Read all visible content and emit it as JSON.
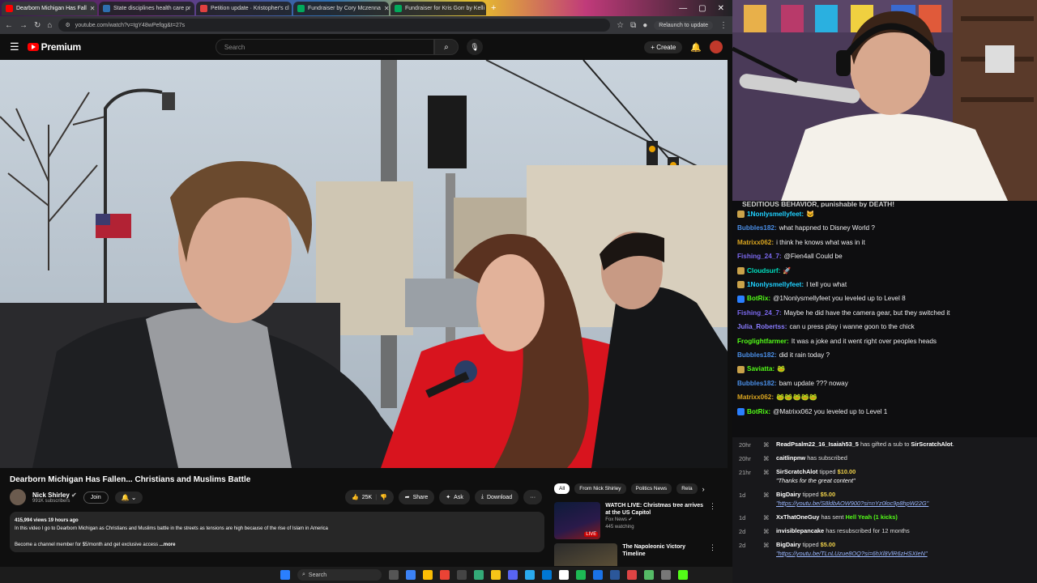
{
  "browser": {
    "tabs": [
      {
        "label": "Dearborn Michigan Has Fall",
        "color": "#ff0000",
        "active": true
      },
      {
        "label": "State disciplines health care pr",
        "color": "#2e6fb0",
        "active": false
      },
      {
        "label": "Petition update · Kristopher's cl",
        "color": "#e04040",
        "active": false
      },
      {
        "label": "Fundraiser by Cory Mczenna",
        "color": "#02a95c",
        "active": false
      },
      {
        "label": "Fundraiser for Kris Gorr by Kelli",
        "color": "#02a95c",
        "active": false
      }
    ],
    "new_tab": "+",
    "url": "youtube.com/watch?v=tgY48wPefqg&t=27s",
    "relaunch": "Relaunch to update"
  },
  "youtube": {
    "logo": "Premium",
    "search_placeholder": "Search",
    "create": "+ Create",
    "video_title": "Dearborn Michigan Has Fallen... Christians and Muslims Battle",
    "channel": {
      "name": "Nick Shirley",
      "subs": "991K subscribers",
      "join": "Join",
      "bell": "🔔 ⌄"
    },
    "actions": {
      "likes": "25K",
      "share": "Share",
      "ask": "Ask",
      "download": "Download",
      "more": "···"
    },
    "description": {
      "meta": "415,994 views  19 hours ago",
      "line1": "In this video I go to Dearborn Michigan as Christians and Muslims battle in the streets as tensions are high because of the rise of Islam in America",
      "line2": "Become a channel member for $5/month and get exclusive access",
      "more": "...more"
    },
    "chips": [
      "All",
      "From Nick Shirley",
      "Politics News",
      "Rela"
    ],
    "recommendations": [
      {
        "title": "WATCH LIVE: Christmas tree arrives at the US Capitol",
        "channel": "Fox News ✔",
        "meta": "445 watching",
        "live": "LIVE"
      },
      {
        "title": "The Napoleonic Victory Timeline",
        "channel": "",
        "meta": "",
        "live": ""
      }
    ]
  },
  "taskbar": {
    "search": "Search"
  },
  "chat": {
    "header": "SEDITIOUS BEHAVIOR, punishable by DEATH!",
    "messages": [
      {
        "user": "1Nonlysmellyfeet:",
        "color": "#1fd1ff",
        "msg": "🐱",
        "badge": "#caa24a"
      },
      {
        "user": "Bubbles182:",
        "color": "#4a8ee6",
        "msg": "what happned to Disney World ?",
        "badge": ""
      },
      {
        "user": "Matrixx062:",
        "color": "#daa520",
        "msg": "i think he knows what was in it",
        "badge": ""
      },
      {
        "user": "Fishing_24_7:",
        "color": "#7b68ee",
        "msg": "@Fien4all Could be",
        "badge": ""
      },
      {
        "user": "Cloudsurf:",
        "color": "#00e0c0",
        "msg": "🚀",
        "badge": "#caa24a"
      },
      {
        "user": "1Nonlysmellyfeet:",
        "color": "#1fd1ff",
        "msg": "I tell you what",
        "badge": "#caa24a"
      },
      {
        "user": "BotRix:",
        "color": "#53fc18",
        "msg": "@1Nonlysmellyfeet you leveled up to Level 8",
        "badge": "#2a7fff"
      },
      {
        "user": "Fishing_24_7:",
        "color": "#7b68ee",
        "msg": "Maybe he did have the camera gear, but they switched it",
        "badge": ""
      },
      {
        "user": "Julia_Robertss:",
        "color": "#8a7cff",
        "msg": "can u press play i wanne goon to the chick",
        "badge": ""
      },
      {
        "user": "Froglightfarmer:",
        "color": "#53fc18",
        "msg": "It was a joke and it went right over peoples heads",
        "badge": ""
      },
      {
        "user": "Bubbles182:",
        "color": "#4a8ee6",
        "msg": "did it rain today ?",
        "badge": ""
      },
      {
        "user": "Saviatta:",
        "color": "#53fc18",
        "msg": "🐸",
        "badge": "#caa24a"
      },
      {
        "user": "Bubbles182:",
        "color": "#4a8ee6",
        "msg": "bam update ??? noway",
        "badge": ""
      },
      {
        "user": "Matrixx062:",
        "color": "#daa520",
        "msg": "🐸🐸🐸🐸🐸",
        "badge": ""
      },
      {
        "user": "BotRix:",
        "color": "#53fc18",
        "msg": "@Matrixx062 you leveled up to Level 1",
        "badge": "#2a7fff"
      }
    ]
  },
  "events": [
    {
      "age": "20hr",
      "name": "ReadPsalm22_16_Isaiah53_5",
      "text": " has gifted a sub to ",
      "target": "SirScratchAlot",
      "end": "."
    },
    {
      "age": "20hr",
      "name": "caitlinpnw",
      "text": " has subscribed",
      "target": "",
      "end": ""
    },
    {
      "age": "21hr",
      "name": "SirScratchAlot",
      "text": " tipped ",
      "amount": "$10.00",
      "quote": "\"Thanks for the great content\""
    },
    {
      "age": "1d",
      "name": "BigDairy",
      "text": " tipped ",
      "amount": "$5.00",
      "link": "\"https://youtu.be/S8ldbAOW900?si=nYz0loc9p8hpW22G\""
    },
    {
      "age": "1d",
      "name": "XxThatOneGuy",
      "text": " has sent ",
      "kick": "Hell Yeah (1 kicks)"
    },
    {
      "age": "2d",
      "name": "invisiblepancake",
      "text": " has resubscribed for 12 months",
      "target": "",
      "end": ""
    },
    {
      "age": "2d",
      "name": "BigDairy",
      "text": " tipped ",
      "amount": "$5.00",
      "link": "\"https://youtu.be/TLnLUzue8OQ?si=6hXl8VlR6zHSXIeN\""
    }
  ]
}
